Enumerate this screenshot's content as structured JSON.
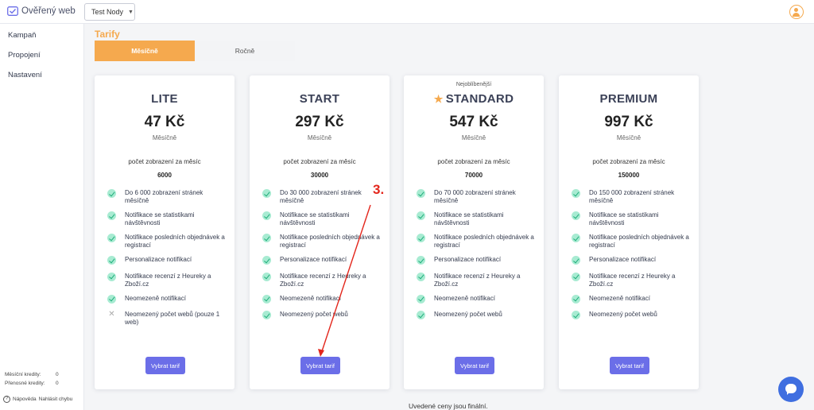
{
  "app": {
    "brand": "Ověřený web",
    "project": "Test Nody"
  },
  "sidebar": {
    "items": [
      {
        "label": "Kampaň"
      },
      {
        "label": "Propojení"
      },
      {
        "label": "Nastavení"
      }
    ],
    "credits": [
      {
        "label": "Měsíční kredity:",
        "value": "0"
      },
      {
        "label": "Přenosné kredity:",
        "value": "0"
      }
    ],
    "help_label": "Nápověda",
    "report_label": "Nahlásit chybu"
  },
  "page": {
    "title": "Tarify",
    "tabs": [
      {
        "label": "Měsíčně",
        "active": true
      },
      {
        "label": "Ročně",
        "active": false
      }
    ],
    "footer_note": "Uvedené ceny jsou finální."
  },
  "plans": [
    {
      "badge": "",
      "name": "LITE",
      "price": "47 Kč",
      "period": "Měsíčně",
      "views_label": "počet zobrazení za měsíc",
      "views_value": "6000",
      "features": [
        {
          "text": "Do 6 000 zobrazení stránek měsíčně",
          "included": true
        },
        {
          "text": "Notifikace se statistikami návštěvnosti",
          "included": true
        },
        {
          "text": "Notifikace posledních objednávek a registrací",
          "included": true
        },
        {
          "text": "Personalizace notifikací",
          "included": true
        },
        {
          "text": "Notifikace recenzí z Heureky a Zboží.cz",
          "included": true
        },
        {
          "text": "Neomezeně notifikací",
          "included": true
        },
        {
          "text": "Neomezený počet webů (pouze 1 web)",
          "included": false
        }
      ],
      "button": "Vybrat tarif"
    },
    {
      "badge": "",
      "name": "START",
      "price": "297 Kč",
      "period": "Měsíčně",
      "views_label": "počet zobrazení za měsíc",
      "views_value": "30000",
      "features": [
        {
          "text": "Do 30 000 zobrazení stránek měsíčně",
          "included": true
        },
        {
          "text": "Notifikace se statistikami návštěvnosti",
          "included": true
        },
        {
          "text": "Notifikace posledních objednávek a registrací",
          "included": true
        },
        {
          "text": "Personalizace notifikací",
          "included": true
        },
        {
          "text": "Notifikace recenzí z Heureky a Zboží.cz",
          "included": true
        },
        {
          "text": "Neomezeně notifikací",
          "included": true
        },
        {
          "text": "Neomezený počet webů",
          "included": true
        }
      ],
      "button": "Vybrat tarif"
    },
    {
      "badge": "Nejoblíbenější",
      "name": "STANDARD",
      "price": "547 Kč",
      "period": "Měsíčně",
      "views_label": "počet zobrazení za měsíc",
      "views_value": "70000",
      "features": [
        {
          "text": "Do 70 000 zobrazení stránek měsíčně",
          "included": true
        },
        {
          "text": "Notifikace se statistikami návštěvnosti",
          "included": true
        },
        {
          "text": "Notifikace posledních objednávek a registrací",
          "included": true
        },
        {
          "text": "Personalizace notifikací",
          "included": true
        },
        {
          "text": "Notifikace recenzí z Heureky a Zboží.cz",
          "included": true
        },
        {
          "text": "Neomezeně notifikací",
          "included": true
        },
        {
          "text": "Neomezený počet webů",
          "included": true
        }
      ],
      "button": "Vybrat tarif"
    },
    {
      "badge": "",
      "name": "PREMIUM",
      "price": "997 Kč",
      "period": "Měsíčně",
      "views_label": "počet zobrazení za měsíc",
      "views_value": "150000",
      "features": [
        {
          "text": "Do 150 000 zobrazení stránek měsíčně",
          "included": true
        },
        {
          "text": "Notifikace se statistikami návštěvnosti",
          "included": true
        },
        {
          "text": "Notifikace posledních objednávek a registrací",
          "included": true
        },
        {
          "text": "Personalizace notifikací",
          "included": true
        },
        {
          "text": "Notifikace recenzí z Heureky a Zboží.cz",
          "included": true
        },
        {
          "text": "Neomezeně notifikací",
          "included": true
        },
        {
          "text": "Neomezený počet webů",
          "included": true
        }
      ],
      "button": "Vybrat tarif"
    }
  ],
  "annotation": {
    "step": "3."
  },
  "icons": {
    "check": "check-icon",
    "cross": "cross-icon",
    "star": "star-icon",
    "chat": "chat-icon",
    "user": "user-icon",
    "logo": "logo-check-icon"
  },
  "colors": {
    "accent": "#f5a94e",
    "button": "#6b6ee8",
    "check_bg": "#a8ebd2",
    "annotation": "#e3261c",
    "chat": "#3f6ee0"
  }
}
